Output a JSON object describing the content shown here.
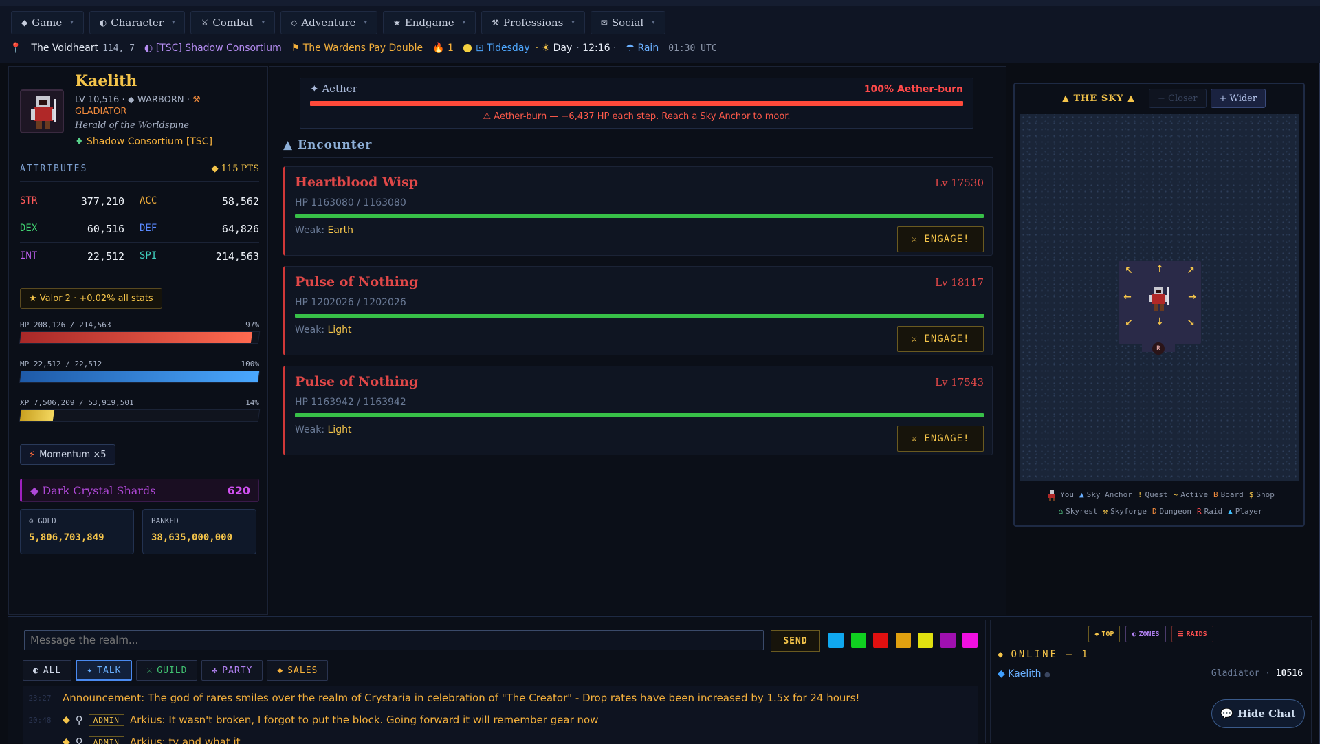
{
  "menu": [
    {
      "icon": "◆",
      "label": "Game"
    },
    {
      "icon": "◐",
      "label": "Character"
    },
    {
      "icon": "⚔",
      "label": "Combat"
    },
    {
      "icon": "◇",
      "label": "Adventure"
    },
    {
      "icon": "★",
      "label": "Endgame"
    },
    {
      "icon": "⚒",
      "label": "Professions"
    },
    {
      "icon": "✉",
      "label": "Social"
    }
  ],
  "status": {
    "location": "The Voidheart",
    "coords": "114, 7",
    "guild": "[TSC] Shadow Consortium",
    "event": "The Wardens Pay Double",
    "streak": "1",
    "weekday": "Tidesday",
    "phase": "Day",
    "time": "12:16",
    "weather": "Rain",
    "utc": "01:30 UTC"
  },
  "hero": {
    "name": "Kaelith",
    "level": "LV 10,516",
    "race": "WARBORN",
    "class": "GLADIATOR",
    "title": "Herald of the Worldspine",
    "guild_name": "Shadow Consortium",
    "guild_tag": "[TSC]"
  },
  "attributes": {
    "title": "ATTRIBUTES",
    "points": "115 PTS",
    "rows": [
      [
        {
          "k": "STR",
          "v": "377,210",
          "c": "#ff5a5a"
        },
        {
          "k": "ACC",
          "v": "58,562",
          "c": "#f4b03c"
        }
      ],
      [
        {
          "k": "DEX",
          "v": "60,516",
          "c": "#40d070"
        },
        {
          "k": "DEF",
          "v": "64,826",
          "c": "#5a8aff"
        }
      ],
      [
        {
          "k": "INT",
          "v": "22,512",
          "c": "#c060f0"
        },
        {
          "k": "SPI",
          "v": "214,563",
          "c": "#40d0c0"
        }
      ]
    ]
  },
  "valor": "★ Valor 2 · +0.02% all stats",
  "bars": {
    "hp": {
      "label": "HP 208,126 / 214,563",
      "pct_label": "97%",
      "fraction": 0.97
    },
    "mp": {
      "label": "MP 22,512 / 22,512",
      "pct_label": "100%",
      "fraction": 1.0
    },
    "xp": {
      "label": "XP 7,506,209 / 53,919,501",
      "pct_label": "14%",
      "fraction": 0.14
    }
  },
  "momentum": "Momentum ×5",
  "shards": {
    "label": "Dark Crystal Shards",
    "value": "620"
  },
  "gold": {
    "label": "GOLD",
    "value": "5,806,703,849"
  },
  "banked": {
    "label": "BANKED",
    "value": "38,635,000,000"
  },
  "aether": {
    "title": "✦ Aether",
    "burn": "100% Aether-burn",
    "fraction": 1.0,
    "warning": "⚠ Aether-burn — −6,437 HP each step. Reach a Sky Anchor to moor."
  },
  "encounter_title": "▲ Encounter",
  "enemies": [
    {
      "name": "Heartblood Wisp",
      "level": "Lv 17530",
      "hp": "HP 1163080 / 1163080",
      "fraction": 1.0,
      "weak_label": "Weak:",
      "weak": "Earth",
      "engage": "⚔ ENGAGE!"
    },
    {
      "name": "Pulse of Nothing",
      "level": "Lv 18117",
      "hp": "HP 1202026 / 1202026",
      "fraction": 1.0,
      "weak_label": "Weak:",
      "weak": "Light",
      "engage": "⚔ ENGAGE!"
    },
    {
      "name": "Pulse of Nothing",
      "level": "Lv 17543",
      "hp": "HP 1163942 / 1163942",
      "fraction": 1.0,
      "weak_label": "Weak:",
      "weak": "Light",
      "engage": "⚔ ENGAGE!"
    }
  ],
  "sky": {
    "title": "▲ THE SKY ▲",
    "closer": "− Closer",
    "wider": "+ Wider",
    "marker_r": "R",
    "legend": [
      {
        "sym": "",
        "label": "You",
        "cls": ""
      },
      {
        "sym": "▲",
        "label": "Sky Anchor",
        "cls": "lg-b"
      },
      {
        "sym": "!",
        "label": "Quest",
        "cls": "lg-y"
      },
      {
        "sym": "~",
        "label": "Active",
        "cls": "lg-y"
      },
      {
        "sym": "B",
        "label": "Board",
        "cls": "lg-o"
      },
      {
        "sym": "$",
        "label": "Shop",
        "cls": "lg-y"
      },
      {
        "sym": "⌂",
        "label": "Skyrest",
        "cls": "lg-g"
      },
      {
        "sym": "⚒",
        "label": "Skyforge",
        "cls": "lg-y"
      },
      {
        "sym": "D",
        "label": "Dungeon",
        "cls": "lg-o"
      },
      {
        "sym": "R",
        "label": "Raid",
        "cls": "lg-r"
      },
      {
        "sym": "▲",
        "label": "Player",
        "cls": "lg-c"
      }
    ]
  },
  "chat": {
    "placeholder": "Message the realm...",
    "send": "SEND",
    "colors": [
      "#10a8f0",
      "#10d020",
      "#e01010",
      "#e0a010",
      "#e0e010",
      "#a010b0",
      "#f010e0"
    ],
    "tabs": [
      {
        "icon": "◐",
        "label": "ALL",
        "color": "#d0d8e8"
      },
      {
        "icon": "✦",
        "label": "TALK",
        "color": "#6ab0ff"
      },
      {
        "icon": "⚔",
        "label": "GUILD",
        "color": "#40c070"
      },
      {
        "icon": "✤",
        "label": "PARTY",
        "color": "#b080f0"
      },
      {
        "icon": "◆",
        "label": "SALES",
        "color": "#f4b03c"
      }
    ],
    "messages": [
      {
        "ts": "23:27",
        "text": "Announcement: The god of rares smiles over the realm of Crystaria in celebration of \"The Creator\" - Drop rates have been increased by 1.5x for 24 hours!"
      },
      {
        "ts": "20:48",
        "badge": "ADMIN",
        "text": "Arkius: It wasn't broken, I forgot to put the block. Going forward it will remember gear now"
      },
      {
        "ts": "",
        "badge": "ADMIN",
        "text": "Arkius: ty and what it..."
      }
    ]
  },
  "online": {
    "tabs": [
      {
        "icon": "◆",
        "label": "TOP",
        "color": "#f4c44a",
        "border": "#6a5a20"
      },
      {
        "icon": "◐",
        "label": "ZONES",
        "color": "#b080f0",
        "border": "#4a3a6a"
      },
      {
        "icon": "☰",
        "label": "RAIDS",
        "color": "#ff5050",
        "border": "#6a2a2a"
      }
    ],
    "title": "ONLINE — 1",
    "player": {
      "name": "Kaelith",
      "class": "Gladiator",
      "level": "10516"
    }
  },
  "hide_chat": "Hide Chat"
}
